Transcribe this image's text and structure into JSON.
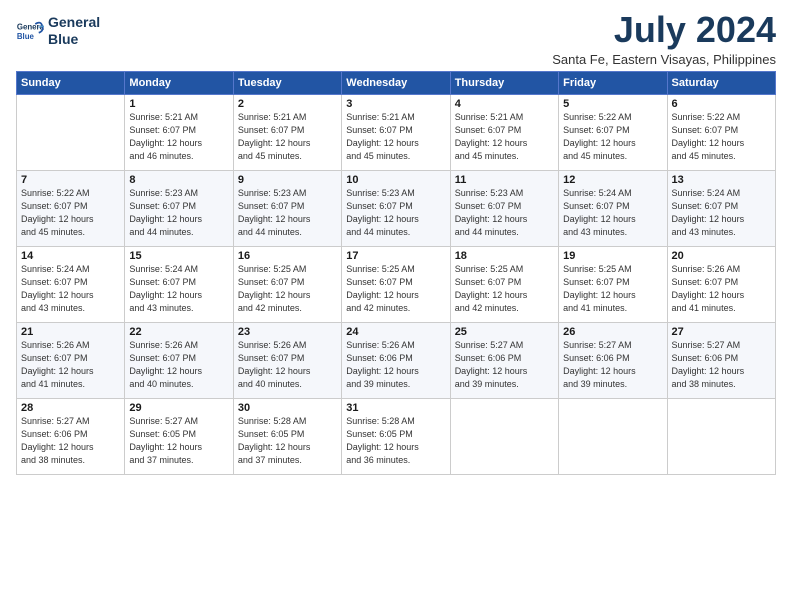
{
  "header": {
    "logo_line1": "General",
    "logo_line2": "Blue",
    "month_year": "July 2024",
    "subtitle": "Santa Fe, Eastern Visayas, Philippines"
  },
  "weekdays": [
    "Sunday",
    "Monday",
    "Tuesday",
    "Wednesday",
    "Thursday",
    "Friday",
    "Saturday"
  ],
  "weeks": [
    [
      {
        "day": "",
        "info": ""
      },
      {
        "day": "1",
        "info": "Sunrise: 5:21 AM\nSunset: 6:07 PM\nDaylight: 12 hours\nand 46 minutes."
      },
      {
        "day": "2",
        "info": "Sunrise: 5:21 AM\nSunset: 6:07 PM\nDaylight: 12 hours\nand 45 minutes."
      },
      {
        "day": "3",
        "info": "Sunrise: 5:21 AM\nSunset: 6:07 PM\nDaylight: 12 hours\nand 45 minutes."
      },
      {
        "day": "4",
        "info": "Sunrise: 5:21 AM\nSunset: 6:07 PM\nDaylight: 12 hours\nand 45 minutes."
      },
      {
        "day": "5",
        "info": "Sunrise: 5:22 AM\nSunset: 6:07 PM\nDaylight: 12 hours\nand 45 minutes."
      },
      {
        "day": "6",
        "info": "Sunrise: 5:22 AM\nSunset: 6:07 PM\nDaylight: 12 hours\nand 45 minutes."
      }
    ],
    [
      {
        "day": "7",
        "info": "Sunrise: 5:22 AM\nSunset: 6:07 PM\nDaylight: 12 hours\nand 45 minutes."
      },
      {
        "day": "8",
        "info": "Sunrise: 5:23 AM\nSunset: 6:07 PM\nDaylight: 12 hours\nand 44 minutes."
      },
      {
        "day": "9",
        "info": "Sunrise: 5:23 AM\nSunset: 6:07 PM\nDaylight: 12 hours\nand 44 minutes."
      },
      {
        "day": "10",
        "info": "Sunrise: 5:23 AM\nSunset: 6:07 PM\nDaylight: 12 hours\nand 44 minutes."
      },
      {
        "day": "11",
        "info": "Sunrise: 5:23 AM\nSunset: 6:07 PM\nDaylight: 12 hours\nand 44 minutes."
      },
      {
        "day": "12",
        "info": "Sunrise: 5:24 AM\nSunset: 6:07 PM\nDaylight: 12 hours\nand 43 minutes."
      },
      {
        "day": "13",
        "info": "Sunrise: 5:24 AM\nSunset: 6:07 PM\nDaylight: 12 hours\nand 43 minutes."
      }
    ],
    [
      {
        "day": "14",
        "info": "Sunrise: 5:24 AM\nSunset: 6:07 PM\nDaylight: 12 hours\nand 43 minutes."
      },
      {
        "day": "15",
        "info": "Sunrise: 5:24 AM\nSunset: 6:07 PM\nDaylight: 12 hours\nand 43 minutes."
      },
      {
        "day": "16",
        "info": "Sunrise: 5:25 AM\nSunset: 6:07 PM\nDaylight: 12 hours\nand 42 minutes."
      },
      {
        "day": "17",
        "info": "Sunrise: 5:25 AM\nSunset: 6:07 PM\nDaylight: 12 hours\nand 42 minutes."
      },
      {
        "day": "18",
        "info": "Sunrise: 5:25 AM\nSunset: 6:07 PM\nDaylight: 12 hours\nand 42 minutes."
      },
      {
        "day": "19",
        "info": "Sunrise: 5:25 AM\nSunset: 6:07 PM\nDaylight: 12 hours\nand 41 minutes."
      },
      {
        "day": "20",
        "info": "Sunrise: 5:26 AM\nSunset: 6:07 PM\nDaylight: 12 hours\nand 41 minutes."
      }
    ],
    [
      {
        "day": "21",
        "info": "Sunrise: 5:26 AM\nSunset: 6:07 PM\nDaylight: 12 hours\nand 41 minutes."
      },
      {
        "day": "22",
        "info": "Sunrise: 5:26 AM\nSunset: 6:07 PM\nDaylight: 12 hours\nand 40 minutes."
      },
      {
        "day": "23",
        "info": "Sunrise: 5:26 AM\nSunset: 6:07 PM\nDaylight: 12 hours\nand 40 minutes."
      },
      {
        "day": "24",
        "info": "Sunrise: 5:26 AM\nSunset: 6:06 PM\nDaylight: 12 hours\nand 39 minutes."
      },
      {
        "day": "25",
        "info": "Sunrise: 5:27 AM\nSunset: 6:06 PM\nDaylight: 12 hours\nand 39 minutes."
      },
      {
        "day": "26",
        "info": "Sunrise: 5:27 AM\nSunset: 6:06 PM\nDaylight: 12 hours\nand 39 minutes."
      },
      {
        "day": "27",
        "info": "Sunrise: 5:27 AM\nSunset: 6:06 PM\nDaylight: 12 hours\nand 38 minutes."
      }
    ],
    [
      {
        "day": "28",
        "info": "Sunrise: 5:27 AM\nSunset: 6:06 PM\nDaylight: 12 hours\nand 38 minutes."
      },
      {
        "day": "29",
        "info": "Sunrise: 5:27 AM\nSunset: 6:05 PM\nDaylight: 12 hours\nand 37 minutes."
      },
      {
        "day": "30",
        "info": "Sunrise: 5:28 AM\nSunset: 6:05 PM\nDaylight: 12 hours\nand 37 minutes."
      },
      {
        "day": "31",
        "info": "Sunrise: 5:28 AM\nSunset: 6:05 PM\nDaylight: 12 hours\nand 36 minutes."
      },
      {
        "day": "",
        "info": ""
      },
      {
        "day": "",
        "info": ""
      },
      {
        "day": "",
        "info": ""
      }
    ]
  ]
}
